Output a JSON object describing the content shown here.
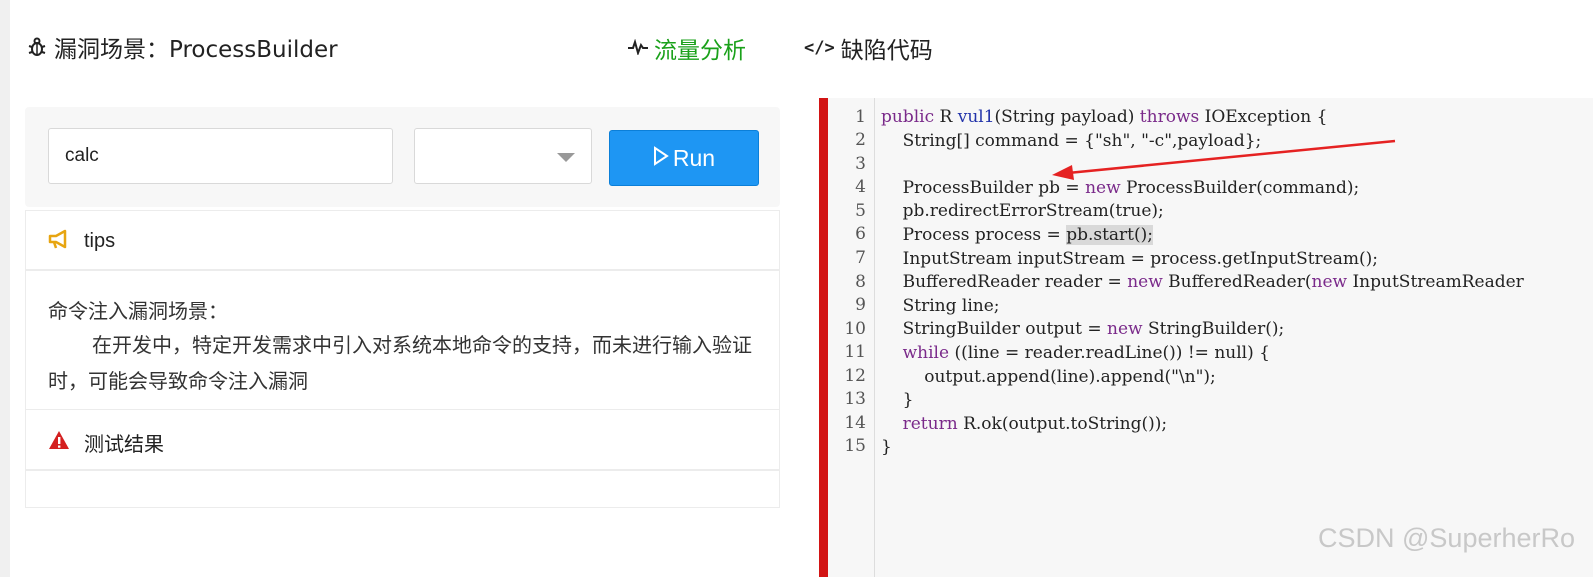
{
  "header": {
    "title": "漏洞场景：ProcessBuilder",
    "tabs": [
      {
        "label": "流量分析",
        "icon": "activity-icon",
        "active": true
      },
      {
        "label": "缺陷代码",
        "icon": "code-icon",
        "active": false
      }
    ]
  },
  "run": {
    "input_value": "calc",
    "select_value": "",
    "button_label": "Run"
  },
  "tips": {
    "title": "tips",
    "description_title": "命令注入漏洞场景：",
    "description": "在开发中，特定开发需求中引入对系统本地命令的支持，而未进行输入验证时，可能会导致命令注入漏洞"
  },
  "result": {
    "title": "测试结果"
  },
  "code": {
    "line_numbers": [
      "1",
      "2",
      "3",
      "4",
      "5",
      "6",
      "7",
      "8",
      "9",
      "10",
      "11",
      "12",
      "13",
      "14",
      "15"
    ],
    "lines": [
      "public R vul1(String payload) throws IOException {",
      "    String[] command = {\"sh\", \"-c\",payload};",
      "",
      "    ProcessBuilder pb = new ProcessBuilder(command);",
      "    pb.redirectErrorStream(true);",
      "    Process process = pb.start();",
      "    InputStream inputStream = process.getInputStream();",
      "    BufferedReader reader = new BufferedReader(new InputStreamReader",
      "    String line;",
      "    StringBuilder output = new StringBuilder();",
      "    while ((line = reader.readLine()) != null) {",
      "        output.append(line).append(\"\\n\");",
      "    }",
      "    return R.ok(output.toString());",
      "}"
    ]
  },
  "watermark": "CSDN @SuperherRo",
  "colors": {
    "accent": "#1aa11a",
    "run_button": "#1e96f3",
    "editor_bar": "#d21414",
    "keyword": "#7a2a8a"
  }
}
